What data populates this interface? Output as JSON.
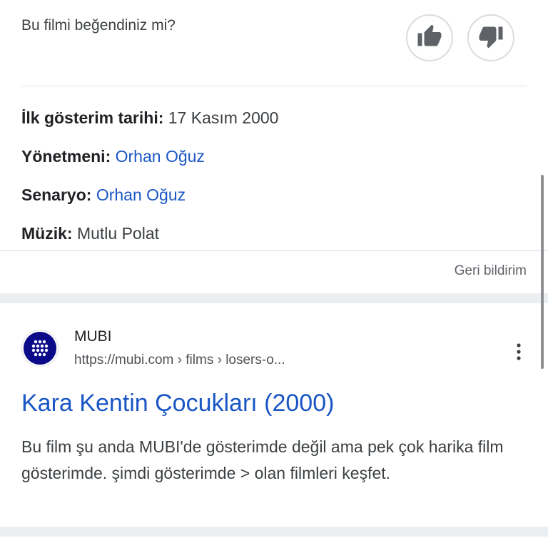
{
  "rating": {
    "question": "Bu filmi beğendiniz mi?",
    "up_icon": "thumbs-up-icon",
    "down_icon": "thumbs-down-icon"
  },
  "facts": [
    {
      "label": "İlk gösterim tarihi:",
      "value": "17 Kasım 2000",
      "is_link": false
    },
    {
      "label": "Yönetmeni:",
      "value": "Orhan Oğuz",
      "is_link": true
    },
    {
      "label": "Senaryo:",
      "value": "Orhan Oğuz",
      "is_link": true
    },
    {
      "label": "Müzik:",
      "value": "Mutlu Polat",
      "is_link": false
    }
  ],
  "feedback_label": "Geri bildirim",
  "result": {
    "site_name": "MUBI",
    "url": "https://mubi.com › films › losers-o...",
    "favicon_icon": "mubi-logo-icon",
    "more_icon": "more-vert-icon",
    "title": "Kara Kentin Çocukları (2000)",
    "snippet": "Bu film şu anda MUBI'de gösterimde değil ama pek çok harika film gösterimde. şimdi gösterimde > olan filmleri keşfet."
  },
  "colors": {
    "link": "#1a56c4",
    "brand_mubi": "#0b0b8a",
    "band": "#eceff1"
  }
}
